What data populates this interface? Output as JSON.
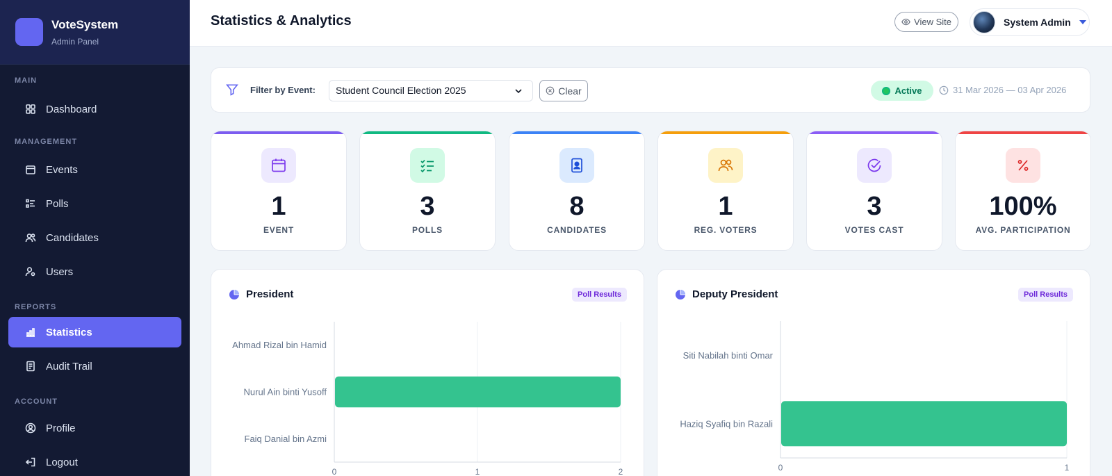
{
  "app": {
    "brand_name": "VoteSystem",
    "brand_sub": "Admin Panel"
  },
  "sidebar": {
    "sections": [
      {
        "label": "MAIN"
      },
      {
        "label": "MANAGEMENT"
      },
      {
        "label": "REPORTS"
      },
      {
        "label": "ACCOUNT"
      }
    ],
    "items": [
      {
        "label": "Dashboard",
        "icon": "grid-icon"
      },
      {
        "label": "Events",
        "icon": "calendar-icon"
      },
      {
        "label": "Polls",
        "icon": "list-icon"
      },
      {
        "label": "Candidates",
        "icon": "users-icon"
      },
      {
        "label": "Users",
        "icon": "user-cog-icon"
      },
      {
        "label": "Statistics",
        "icon": "bar-chart-icon",
        "active": true
      },
      {
        "label": "Audit Trail",
        "icon": "journal-icon"
      },
      {
        "label": "Profile",
        "icon": "person-circle-icon"
      },
      {
        "label": "Logout",
        "icon": "logout-icon"
      }
    ]
  },
  "header": {
    "title": "Statistics & Analytics",
    "view_site": "View Site",
    "user_name": "System Admin"
  },
  "filter": {
    "label": "Filter by Event:",
    "selected_event": "Student Council Election 2025",
    "clear_label": "Clear",
    "status": "Active",
    "date_range": "31 Mar 2026 — 03 Apr 2026"
  },
  "stats": [
    {
      "value": "1",
      "label": "EVENT",
      "icon": "calendar-icon",
      "accent": "#7c5cf0"
    },
    {
      "value": "3",
      "label": "POLLS",
      "icon": "checklist-icon",
      "accent": "#10b981"
    },
    {
      "value": "8",
      "label": "CANDIDATES",
      "icon": "badge-icon",
      "accent": "#3b82f6"
    },
    {
      "value": "1",
      "label": "REG. VOTERS",
      "icon": "users-icon",
      "accent": "#f59e0b"
    },
    {
      "value": "3",
      "label": "VOTES CAST",
      "icon": "check-circle-icon",
      "accent": "#8b5cf6"
    },
    {
      "value": "100%",
      "label": "AVG. PARTICIPATION",
      "icon": "percent-icon",
      "accent": "#ef4444"
    }
  ],
  "charts": [
    {
      "title": "President",
      "badge": "Poll Results"
    },
    {
      "title": "Deputy President",
      "badge": "Poll Results"
    }
  ],
  "chart_data": [
    {
      "type": "bar",
      "orientation": "horizontal",
      "title": "President",
      "categories": [
        "Ahmad Rizal bin Hamid",
        "Nurul Ain binti Yusoff",
        "Faiq Danial bin Azmi"
      ],
      "values": [
        0,
        2,
        0
      ],
      "xlim": [
        0,
        2
      ],
      "x_ticks": [
        "0",
        "1",
        "2"
      ],
      "color": "#34c38f",
      "grid": true
    },
    {
      "type": "bar",
      "orientation": "horizontal",
      "title": "Deputy President",
      "categories": [
        "Siti Nabilah binti Omar",
        "Haziq Syafiq bin Razali"
      ],
      "values": [
        0,
        1
      ],
      "xlim": [
        0,
        1
      ],
      "x_ticks": [
        "0",
        "1"
      ],
      "color": "#34c38f",
      "grid": true
    }
  ]
}
